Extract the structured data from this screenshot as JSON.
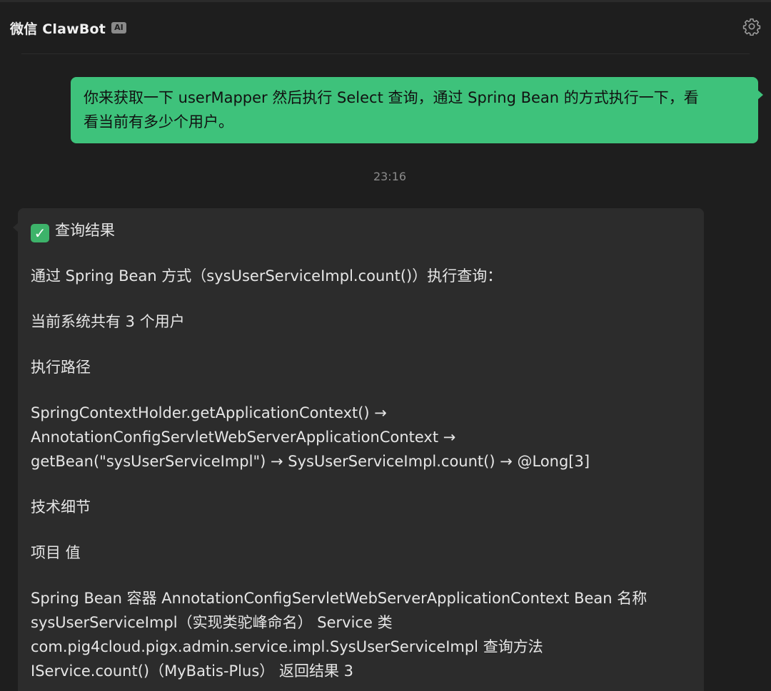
{
  "header": {
    "title": "微信 ClawBot",
    "badge": "AI",
    "settings_icon": "gear-icon"
  },
  "messages": {
    "user": {
      "text": "你来获取一下 userMapper 然后执行 Select 查询，通过 Spring Bean 的方式执行一下，看看当前有多少个用户。",
      "line1": "你来获取一下 userMapper 然后执行 Select 查询，通过 Spring Bean 的方式执行一下，看",
      "line2": "看当前有多少个用户。"
    },
    "timestamp": "23:16",
    "bot": {
      "status_icon": "check-mark-icon",
      "heading": "查询结果",
      "intro": "通过 Spring Bean 方式（sysUserServiceImpl.count()）执行查询：",
      "result": "当前系统共有 3 个用户",
      "path_title": "执行路径",
      "path_lines": [
        "SpringContextHolder.getApplicationContext()   →",
        "AnnotationConfigServletWebServerApplicationContext   →",
        "getBean(\"sysUserServiceImpl\")   → SysUserServiceImpl.count()   → @Long[3]"
      ],
      "details_title": "技术细节",
      "table_header": "项目  值",
      "table_lines": [
        "Spring Bean 容器  AnnotationConfigServletWebServerApplicationContext Bean 名称",
        "sysUserServiceImpl（实现类驼峰命名） Service 类",
        "com.pig4cloud.pigx.admin.service.impl.SysUserServiceImpl 查询方法",
        "IService.count()（MyBatis-Plus） 返回结果  3"
      ]
    }
  },
  "colors": {
    "background": "#1e1e1e",
    "user_bubble": "#3ec27b",
    "bot_bubble": "#2c2c2c",
    "check": "#3db36a"
  }
}
